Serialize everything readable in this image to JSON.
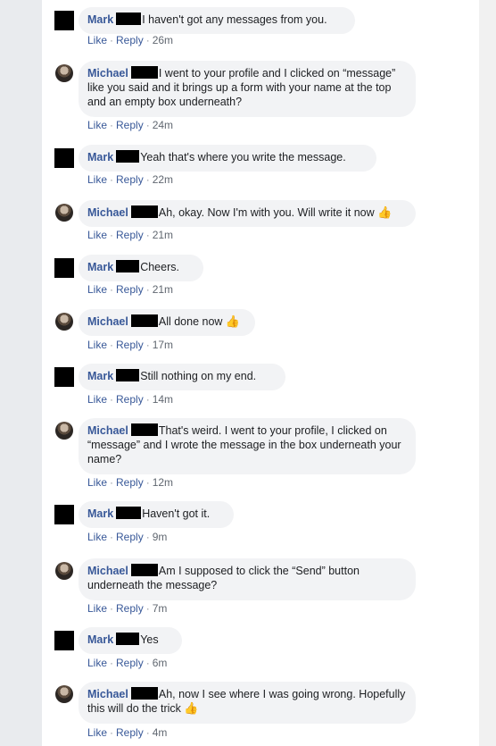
{
  "comments": [
    {
      "author": "Mark",
      "text": "I haven't got any messages from you.",
      "like": "Like",
      "reply": "Reply",
      "time": "26m",
      "thumb": ""
    },
    {
      "author": "Michael",
      "text": "I went to your profile and I clicked on “message” like you said and it brings up a form with your name at the top and an empty box underneath?",
      "like": "Like",
      "reply": "Reply",
      "time": "24m",
      "thumb": ""
    },
    {
      "author": "Mark",
      "text": "Yeah that's where you write the message.",
      "like": "Like",
      "reply": "Reply",
      "time": "22m",
      "thumb": ""
    },
    {
      "author": "Michael",
      "text": "Ah, okay. Now I'm with you. Will write it now",
      "like": "Like",
      "reply": "Reply",
      "time": "21m",
      "thumb": "👍"
    },
    {
      "author": "Mark",
      "text": "Cheers.",
      "like": "Like",
      "reply": "Reply",
      "time": "21m",
      "thumb": ""
    },
    {
      "author": "Michael",
      "text": "All done now",
      "like": "Like",
      "reply": "Reply",
      "time": "17m",
      "thumb": "👍"
    },
    {
      "author": "Mark",
      "text": "Still nothing on my end.",
      "like": "Like",
      "reply": "Reply",
      "time": "14m",
      "thumb": ""
    },
    {
      "author": "Michael",
      "text": "That's weird. I went to your profile, I clicked on “message” and I wrote the message in the box underneath your name?",
      "like": "Like",
      "reply": "Reply",
      "time": "12m",
      "thumb": ""
    },
    {
      "author": "Mark",
      "text": "Haven't got it.",
      "like": "Like",
      "reply": "Reply",
      "time": "9m",
      "thumb": ""
    },
    {
      "author": "Michael",
      "text": "Am I supposed to click the “Send” button underneath the message?",
      "like": "Like",
      "reply": "Reply",
      "time": "7m",
      "thumb": ""
    },
    {
      "author": "Mark",
      "text": "Yes",
      "like": "Like",
      "reply": "Reply",
      "time": "6m",
      "thumb": ""
    },
    {
      "author": "Michael",
      "text": "Ah, now I see where I was going wrong. Hopefully this will do the trick",
      "like": "Like",
      "reply": "Reply",
      "time": "4m",
      "thumb": "👍"
    }
  ],
  "sep": "·",
  "colors": {
    "link": "#385898",
    "bubble": "#f2f3f5",
    "page_bg": "#e9ebee"
  }
}
